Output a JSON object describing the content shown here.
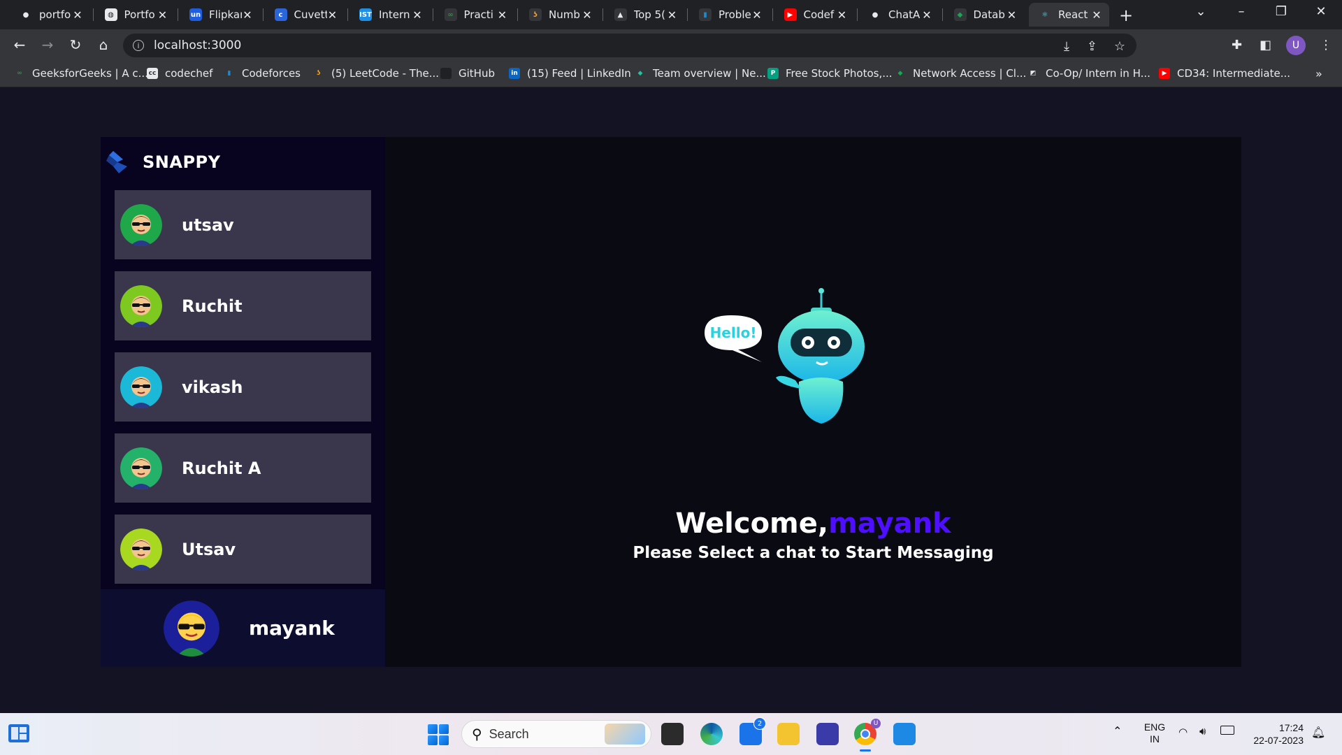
{
  "browser": {
    "tabs": [
      {
        "label": "portfo",
        "icon": "github-icon"
      },
      {
        "label": "Portfo",
        "icon": "globe-icon"
      },
      {
        "label": "Flipkar",
        "icon": "unstop-icon"
      },
      {
        "label": "Cuvett",
        "icon": "cuvette-icon"
      },
      {
        "label": "Intern",
        "icon": "internshala-icon"
      },
      {
        "label": "Practi",
        "icon": "geeksforgeeks-icon"
      },
      {
        "label": "Numb",
        "icon": "leetcode-icon"
      },
      {
        "label": "Top 5(",
        "icon": "mountain-icon"
      },
      {
        "label": "Proble",
        "icon": "codeforces-icon"
      },
      {
        "label": "Codef",
        "icon": "youtube-icon"
      },
      {
        "label": "ChatA",
        "icon": "github-icon"
      },
      {
        "label": "Datab",
        "icon": "mongodb-icon"
      },
      {
        "label": "React",
        "icon": "react-icon",
        "active": true
      }
    ],
    "url": "localhost:3000",
    "profile_initial": "U",
    "bookmarks": [
      {
        "label": "GeeksforGeeks | A c...",
        "icon": "geeksforgeeks-icon"
      },
      {
        "label": "codechef",
        "icon": "codechef-icon"
      },
      {
        "label": "Codeforces",
        "icon": "codeforces-icon"
      },
      {
        "label": "(5) LeetCode - The...",
        "icon": "leetcode-icon"
      },
      {
        "label": "GitHub",
        "icon": "github-icon"
      },
      {
        "label": "(15) Feed | LinkedIn",
        "icon": "linkedin-icon"
      },
      {
        "label": "Team overview | Ne...",
        "icon": "netlify-icon"
      },
      {
        "label": "Free Stock Photos,...",
        "icon": "pexels-icon"
      },
      {
        "label": "Network Access | Cl...",
        "icon": "mongodb-icon"
      },
      {
        "label": "Co-Op/ Intern in H...",
        "icon": "amd-icon"
      },
      {
        "label": "CD34: Intermediate...",
        "icon": "youtube-icon"
      }
    ],
    "bookmarks_overflow": "»"
  },
  "app": {
    "brand": "SNAPPY",
    "contacts": [
      {
        "name": "utsav",
        "avatar_bg": "#1fa84a"
      },
      {
        "name": "Ruchit",
        "avatar_bg": "#7dc920"
      },
      {
        "name": "vikash",
        "avatar_bg": "#1cb8d8"
      },
      {
        "name": "Ruchit A",
        "avatar_bg": "#24b26a"
      },
      {
        "name": "Utsav",
        "avatar_bg": "#a8d820"
      }
    ],
    "current_user": {
      "name": "mayank",
      "avatar_bg": "#1b1f9a"
    },
    "welcome": {
      "prefix": "Welcome,",
      "username": "mayank",
      "subtitle": "Please Select a chat to Start Messaging",
      "robot_speech": "Hello!"
    },
    "accent_color": "#4e0eff"
  },
  "taskbar": {
    "search_label": "Search",
    "mail_badge": "2",
    "chrome_badge": "U",
    "lang_line1": "ENG",
    "lang_line2": "IN",
    "time": "17:24",
    "date": "22-07-2023"
  }
}
